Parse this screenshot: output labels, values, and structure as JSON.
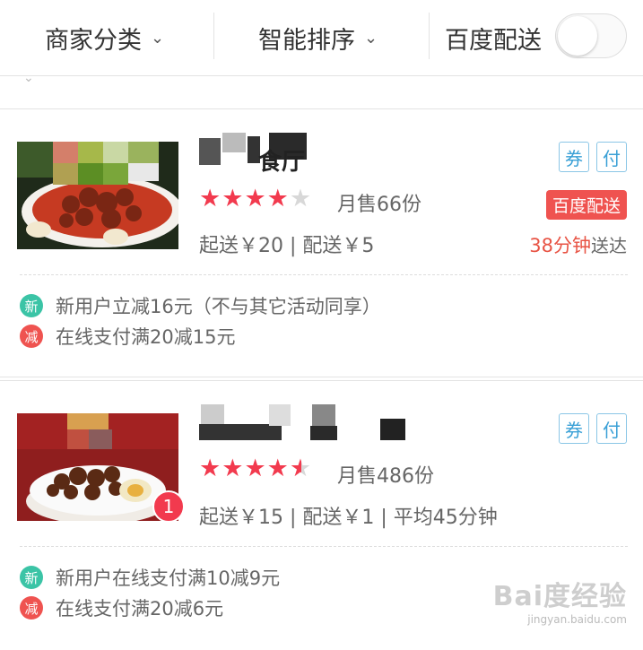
{
  "filter_bar": {
    "category_label": "商家分类",
    "sort_label": "智能排序",
    "baidu_delivery_label": "百度配送"
  },
  "restaurants": [
    {
      "name_visible": "食厅",
      "monthly_sales": "月售66份",
      "rating_stars": 4,
      "meta": "起送￥20 | 配送￥5",
      "coupon_badge": "券",
      "pay_badge": "付",
      "delivery_tag": "百度配送",
      "eta_minutes": "38分钟",
      "eta_suffix": "送达",
      "promotions": [
        {
          "icon": "新",
          "text": "新用户立减16元（不与其它活动同享）"
        },
        {
          "icon": "减",
          "text": "在线支付满20减15元"
        }
      ]
    },
    {
      "name_visible": "",
      "monthly_sales": "月售486份",
      "rating_stars": 4.5,
      "meta": "起送￥15 | 配送￥1 | 平均45分钟",
      "coupon_badge": "券",
      "pay_badge": "付",
      "cart_count": "1",
      "promotions": [
        {
          "icon": "新",
          "text": "新用户在线支付满10减9元"
        },
        {
          "icon": "减",
          "text": "在线支付满20减6元"
        }
      ]
    }
  ],
  "watermark": {
    "main": "Bai度经验",
    "sub": "jingyan.baidu.com"
  },
  "colors": {
    "accent_red": "#f23a4e",
    "badge_blue": "#3aa0d6",
    "new_green": "#3bc4a6"
  }
}
